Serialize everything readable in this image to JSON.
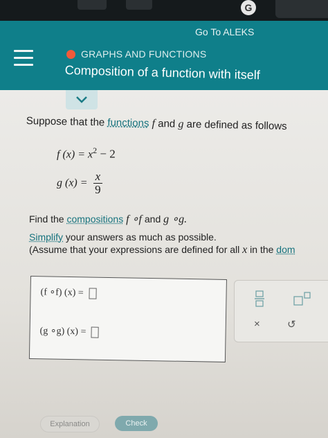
{
  "top_bar": {
    "badge_letter": "G"
  },
  "header": {
    "go_to_label": "Go To ALEKS",
    "topic": "GRAPHS AND FUNCTIONS",
    "lesson_title": "Composition of a function with itself",
    "topic_dot_color": "#f25a3a",
    "accent_color": "#0f7f8a"
  },
  "problem": {
    "intro_prefix": "Suppose that the ",
    "intro_link": "functions",
    "intro_f": "f",
    "intro_and": " and ",
    "intro_g": "g",
    "intro_suffix": " are defined as follows",
    "f_def_lhs": "f (x) = x",
    "f_def_exp": "2",
    "f_def_rest": " − 2",
    "g_def_lhs": "g (x) = ",
    "g_num": "x",
    "g_den": "9",
    "find_prefix": "Find the ",
    "find_link": "compositions",
    "find_f": "f",
    "find_fof": " ∘f",
    "find_and": " and ",
    "find_gog": "g ∘g.",
    "simplify_link": "Simplify",
    "simplify_rest": " your answers as much as possible.",
    "assume_prefix": "(Assume that your expressions are defined for all ",
    "assume_x": "x",
    "assume_mid": " in the ",
    "assume_link": "dom"
  },
  "answers": {
    "fof_label": "(f ∘f) (x) = ",
    "gog_label": "(g ∘g) (x) = "
  },
  "keypad": {
    "times": "×",
    "undo": "↺"
  },
  "footer": {
    "explanation_label": "Explanation",
    "check_label": "Check"
  }
}
